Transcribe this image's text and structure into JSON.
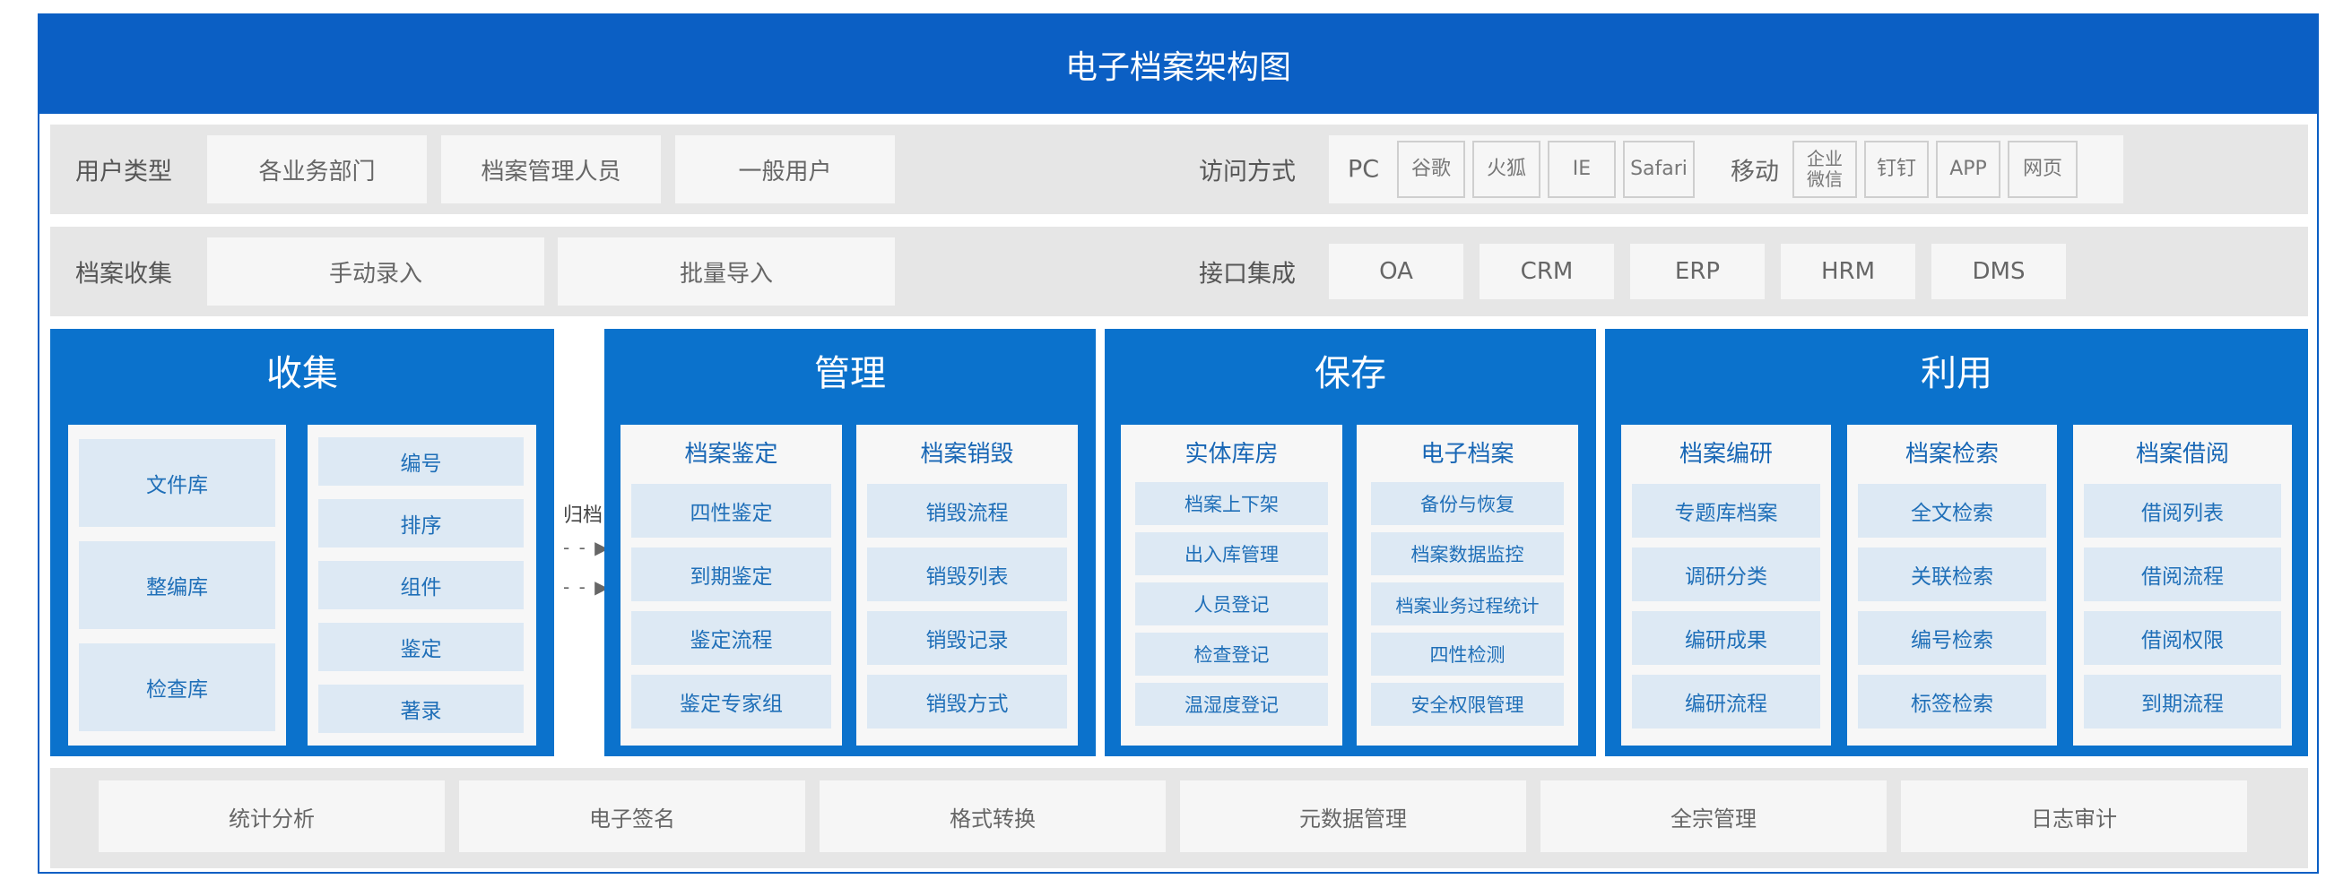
{
  "title": "电子档案架构图",
  "user_row": {
    "label": "用户类型",
    "items": [
      "各业务部门",
      "档案管理人员",
      "一般用户"
    ],
    "access_label": "访问方式",
    "pc_label": "PC",
    "pc_items": [
      "谷歌",
      "火狐",
      "IE",
      "Safari"
    ],
    "mobile_label": "移动",
    "mobile_items": [
      "企业\n微信",
      "钉钉",
      "APP",
      "网页"
    ]
  },
  "collect_row": {
    "label": "档案收集",
    "items": [
      "手动录入",
      "批量导入"
    ],
    "interface_label": "接口集成",
    "interface_items": [
      "OA",
      "CRM",
      "ERP",
      "HRM",
      "DMS"
    ]
  },
  "sections": {
    "collect": {
      "title": "收集",
      "left_items": [
        "文件库",
        "整编库",
        "检查库"
      ],
      "right_items": [
        "编号",
        "排序",
        "组件",
        "鉴定",
        "著录"
      ]
    },
    "archive_label": "归档",
    "arrows": [
      "- - ▶",
      "- - ▶"
    ],
    "manage": {
      "title": "管理",
      "panels": [
        {
          "title": "档案鉴定",
          "items": [
            "四性鉴定",
            "到期鉴定",
            "鉴定流程",
            "鉴定专家组"
          ]
        },
        {
          "title": "档案销毁",
          "items": [
            "销毁流程",
            "销毁列表",
            "销毁记录",
            "销毁方式"
          ]
        }
      ]
    },
    "preserve": {
      "title": "保存",
      "panels": [
        {
          "title": "实体库房",
          "items": [
            "档案上下架",
            "出入库管理",
            "人员登记",
            "检查登记",
            "温湿度登记"
          ]
        },
        {
          "title": "电子档案",
          "items": [
            "备份与恢复",
            "档案数据监控",
            "档案业务过程统计",
            "四性检测",
            "安全权限管理"
          ]
        }
      ]
    },
    "use": {
      "title": "利用",
      "panels": [
        {
          "title": "档案编研",
          "items": [
            "专题库档案",
            "调研分类",
            "编研成果",
            "编研流程"
          ]
        },
        {
          "title": "档案检索",
          "items": [
            "全文检索",
            "关联检索",
            "编号检索",
            "标签检索"
          ]
        },
        {
          "title": "档案借阅",
          "items": [
            "借阅列表",
            "借阅流程",
            "借阅权限",
            "到期流程"
          ]
        }
      ]
    }
  },
  "bottom_items": [
    "统计分析",
    "电子签名",
    "格式转换",
    "元数据管理",
    "全宗管理",
    "日志审计"
  ]
}
